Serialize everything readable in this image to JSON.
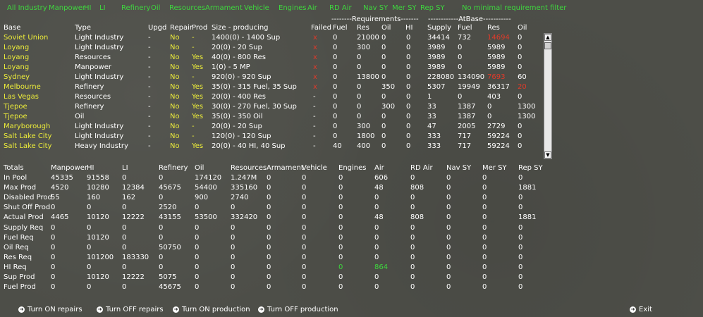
{
  "filters": [
    "All Industry",
    "Manpower",
    "HI",
    "LI",
    "Refinery",
    "Oil",
    "Resources",
    "Armament",
    "Vehicle",
    "Engines",
    "Air",
    "RD Air",
    "Nav SY",
    "Mer SY",
    "Rep SY",
    "No minimal requirement filter"
  ],
  "headers": {
    "base": "Base",
    "type": "Type",
    "upgd": "Upgd",
    "repair": "Repair",
    "prod": "Prod",
    "size": "Size - producing",
    "failed": "Failed",
    "fuel": "Fuel",
    "res": "Res",
    "oil": "Oil",
    "hi": "HI",
    "supply": "Supply",
    "ab_fuel": "Fuel",
    "ab_res": "Res",
    "ab_oil": "Oil",
    "req_group": "--------Requirements-------",
    "atbase_group": "------------AtBase-----------"
  },
  "rows": [
    {
      "base": "Soviet Union",
      "type": "Light Industry",
      "upgd": "-",
      "repair": "No",
      "prod": "-",
      "size": "1400(0) - 1400 Sup",
      "failed": "x",
      "fuel": "0",
      "res": "21000",
      "oil": "0",
      "hi": "0",
      "supply": "34414",
      "ab_fuel": "732",
      "ab_res": "14694",
      "ab_oil": "0",
      "res_red": true,
      "oil_red": false
    },
    {
      "base": "Loyang",
      "type": "Light Industry",
      "upgd": "-",
      "repair": "No",
      "prod": "-",
      "size": "20(0) - 20 Sup",
      "failed": "x",
      "fuel": "0",
      "res": "300",
      "oil": "0",
      "hi": "0",
      "supply": "3989",
      "ab_fuel": "0",
      "ab_res": "5989",
      "ab_oil": "0",
      "res_red": false,
      "oil_red": false
    },
    {
      "base": "Loyang",
      "type": "Resources",
      "upgd": "-",
      "repair": "No",
      "prod": "Yes",
      "size": "40(0) - 800 Res",
      "failed": "x",
      "fuel": "0",
      "res": "0",
      "oil": "0",
      "hi": "0",
      "supply": "3989",
      "ab_fuel": "0",
      "ab_res": "5989",
      "ab_oil": "0",
      "res_red": false,
      "oil_red": false
    },
    {
      "base": "Loyang",
      "type": "Manpower",
      "upgd": "-",
      "repair": "No",
      "prod": "Yes",
      "size": "1(0) - 5 MP",
      "failed": "x",
      "fuel": "0",
      "res": "0",
      "oil": "0",
      "hi": "0",
      "supply": "3989",
      "ab_fuel": "0",
      "ab_res": "5989",
      "ab_oil": "0",
      "res_red": false,
      "oil_red": false
    },
    {
      "base": "Sydney",
      "type": "Light Industry",
      "upgd": "-",
      "repair": "No",
      "prod": "-",
      "size": "920(0) - 920 Sup",
      "failed": "x",
      "fuel": "0",
      "res": "13800",
      "oil": "0",
      "hi": "0",
      "supply": "228080",
      "ab_fuel": "134090",
      "ab_res": "7693",
      "ab_oil": "60",
      "res_red": true,
      "oil_red": false
    },
    {
      "base": "Melbourne",
      "type": "Refinery",
      "upgd": "-",
      "repair": "No",
      "prod": "Yes",
      "size": "35(0) - 315 Fuel, 35 Sup",
      "failed": "x",
      "fuel": "0",
      "res": "0",
      "oil": "350",
      "hi": "0",
      "supply": "5307",
      "ab_fuel": "19949",
      "ab_res": "36317",
      "ab_oil": "20",
      "res_red": false,
      "oil_red": true
    },
    {
      "base": "Las Vegas",
      "type": "Resources",
      "upgd": "-",
      "repair": "No",
      "prod": "Yes",
      "size": "20(0) - 400 Res",
      "failed": "-",
      "fuel": "0",
      "res": "0",
      "oil": "0",
      "hi": "0",
      "supply": "1",
      "ab_fuel": "0",
      "ab_res": "403",
      "ab_oil": "0",
      "res_red": false,
      "oil_red": false
    },
    {
      "base": "Tjepoe",
      "type": "Refinery",
      "upgd": "-",
      "repair": "No",
      "prod": "Yes",
      "size": "30(0) - 270 Fuel, 30 Sup",
      "failed": "-",
      "fuel": "0",
      "res": "0",
      "oil": "300",
      "hi": "0",
      "supply": "33",
      "ab_fuel": "1387",
      "ab_res": "0",
      "ab_oil": "1300",
      "res_red": false,
      "oil_red": false
    },
    {
      "base": "Tjepoe",
      "type": "Oil",
      "upgd": "-",
      "repair": "No",
      "prod": "Yes",
      "size": "35(0) - 350 Oil",
      "failed": "-",
      "fuel": "0",
      "res": "0",
      "oil": "0",
      "hi": "0",
      "supply": "33",
      "ab_fuel": "1387",
      "ab_res": "0",
      "ab_oil": "1300",
      "res_red": false,
      "oil_red": false
    },
    {
      "base": "Maryborough",
      "type": "Light Industry",
      "upgd": "-",
      "repair": "No",
      "prod": "-",
      "size": "20(0) - 20 Sup",
      "failed": "-",
      "fuel": "0",
      "res": "300",
      "oil": "0",
      "hi": "0",
      "supply": "47",
      "ab_fuel": "2005",
      "ab_res": "2729",
      "ab_oil": "0",
      "res_red": false,
      "oil_red": false
    },
    {
      "base": "Salt Lake City",
      "type": "Light Industry",
      "upgd": "-",
      "repair": "No",
      "prod": "-",
      "size": "120(0) - 120 Sup",
      "failed": "-",
      "fuel": "0",
      "res": "1800",
      "oil": "0",
      "hi": "0",
      "supply": "333",
      "ab_fuel": "717",
      "ab_res": "59224",
      "ab_oil": "0",
      "res_red": false,
      "oil_red": false
    },
    {
      "base": "Salt Lake City",
      "type": "Heavy Industry",
      "upgd": "-",
      "repair": "No",
      "prod": "Yes",
      "size": "20(0) - 40 HI, 40 Sup",
      "failed": "-",
      "fuel": "40",
      "res": "400",
      "oil": "0",
      "hi": "0",
      "supply": "333",
      "ab_fuel": "717",
      "ab_res": "59224",
      "ab_oil": "0",
      "res_red": false,
      "oil_red": false
    }
  ],
  "totals_headers": [
    "Totals",
    "Manpower",
    "HI",
    "LI",
    "Refinery",
    "Oil",
    "Resources",
    "Armament",
    "Vehicle",
    "Engines",
    "Air",
    "RD Air",
    "Nav SY",
    "Mer SY",
    "Rep SY"
  ],
  "totals_rows": [
    [
      "In Pool",
      "45335",
      "91558",
      "0",
      "0",
      "174120",
      "1.247M",
      "0",
      "0",
      "0",
      "606",
      "0",
      "0",
      "0",
      "0"
    ],
    [
      "Max Prod",
      "4520",
      "10280",
      "12384",
      "45675",
      "54400",
      "335160",
      "0",
      "0",
      "0",
      "48",
      "808",
      "0",
      "0",
      "1881"
    ],
    [
      "Disabled Prod",
      "55",
      "160",
      "162",
      "0",
      "900",
      "2740",
      "0",
      "0",
      "0",
      "0",
      "0",
      "0",
      "0",
      "0"
    ],
    [
      "Shut Off Prod",
      "0",
      "0",
      "0",
      "2520",
      "0",
      "0",
      "0",
      "0",
      "0",
      "0",
      "0",
      "0",
      "0",
      "0"
    ],
    [
      "Actual Prod",
      "4465",
      "10120",
      "12222",
      "43155",
      "53500",
      "332420",
      "0",
      "0",
      "0",
      "48",
      "808",
      "0",
      "0",
      "1881"
    ],
    [
      "Supply Req",
      "0",
      "0",
      "0",
      "0",
      "0",
      "0",
      "0",
      "0",
      "0",
      "0",
      "0",
      "0",
      "0",
      "0"
    ],
    [
      "Fuel Req",
      "0",
      "10120",
      "0",
      "0",
      "0",
      "0",
      "0",
      "0",
      "0",
      "0",
      "0",
      "0",
      "0",
      "0"
    ],
    [
      "Oil Req",
      "0",
      "0",
      "0",
      "50750",
      "0",
      "0",
      "0",
      "0",
      "0",
      "0",
      "0",
      "0",
      "0",
      "0"
    ],
    [
      "Res Req",
      "0",
      "101200",
      "183330",
      "0",
      "0",
      "0",
      "0",
      "0",
      "0",
      "0",
      "0",
      "0",
      "0",
      "0"
    ],
    [
      "HI Req",
      "0",
      "0",
      "0",
      "0",
      "0",
      "0",
      "0",
      "0",
      "0",
      "864",
      "0",
      "0",
      "0",
      "0"
    ],
    [
      "Sup Prod",
      "0",
      "10120",
      "12222",
      "5075",
      "0",
      "0",
      "0",
      "0",
      "0",
      "0",
      "0",
      "0",
      "0",
      "0"
    ],
    [
      "Fuel Prod",
      "0",
      "0",
      "0",
      "45675",
      "0",
      "0",
      "0",
      "0",
      "0",
      "0",
      "0",
      "0",
      "0",
      "0"
    ]
  ],
  "buttons": {
    "on_repairs": "Turn ON repairs",
    "off_repairs": "Turn OFF repairs",
    "on_prod": "Turn ON production",
    "off_prod": "Turn OFF production",
    "exit": "Exit"
  },
  "scroll": {
    "up": "▲",
    "down": "▼"
  },
  "colors": {
    "green": "#3ed63e",
    "yellow": "#eded3a",
    "red": "#e03a2a",
    "background": "#4d4e48"
  }
}
